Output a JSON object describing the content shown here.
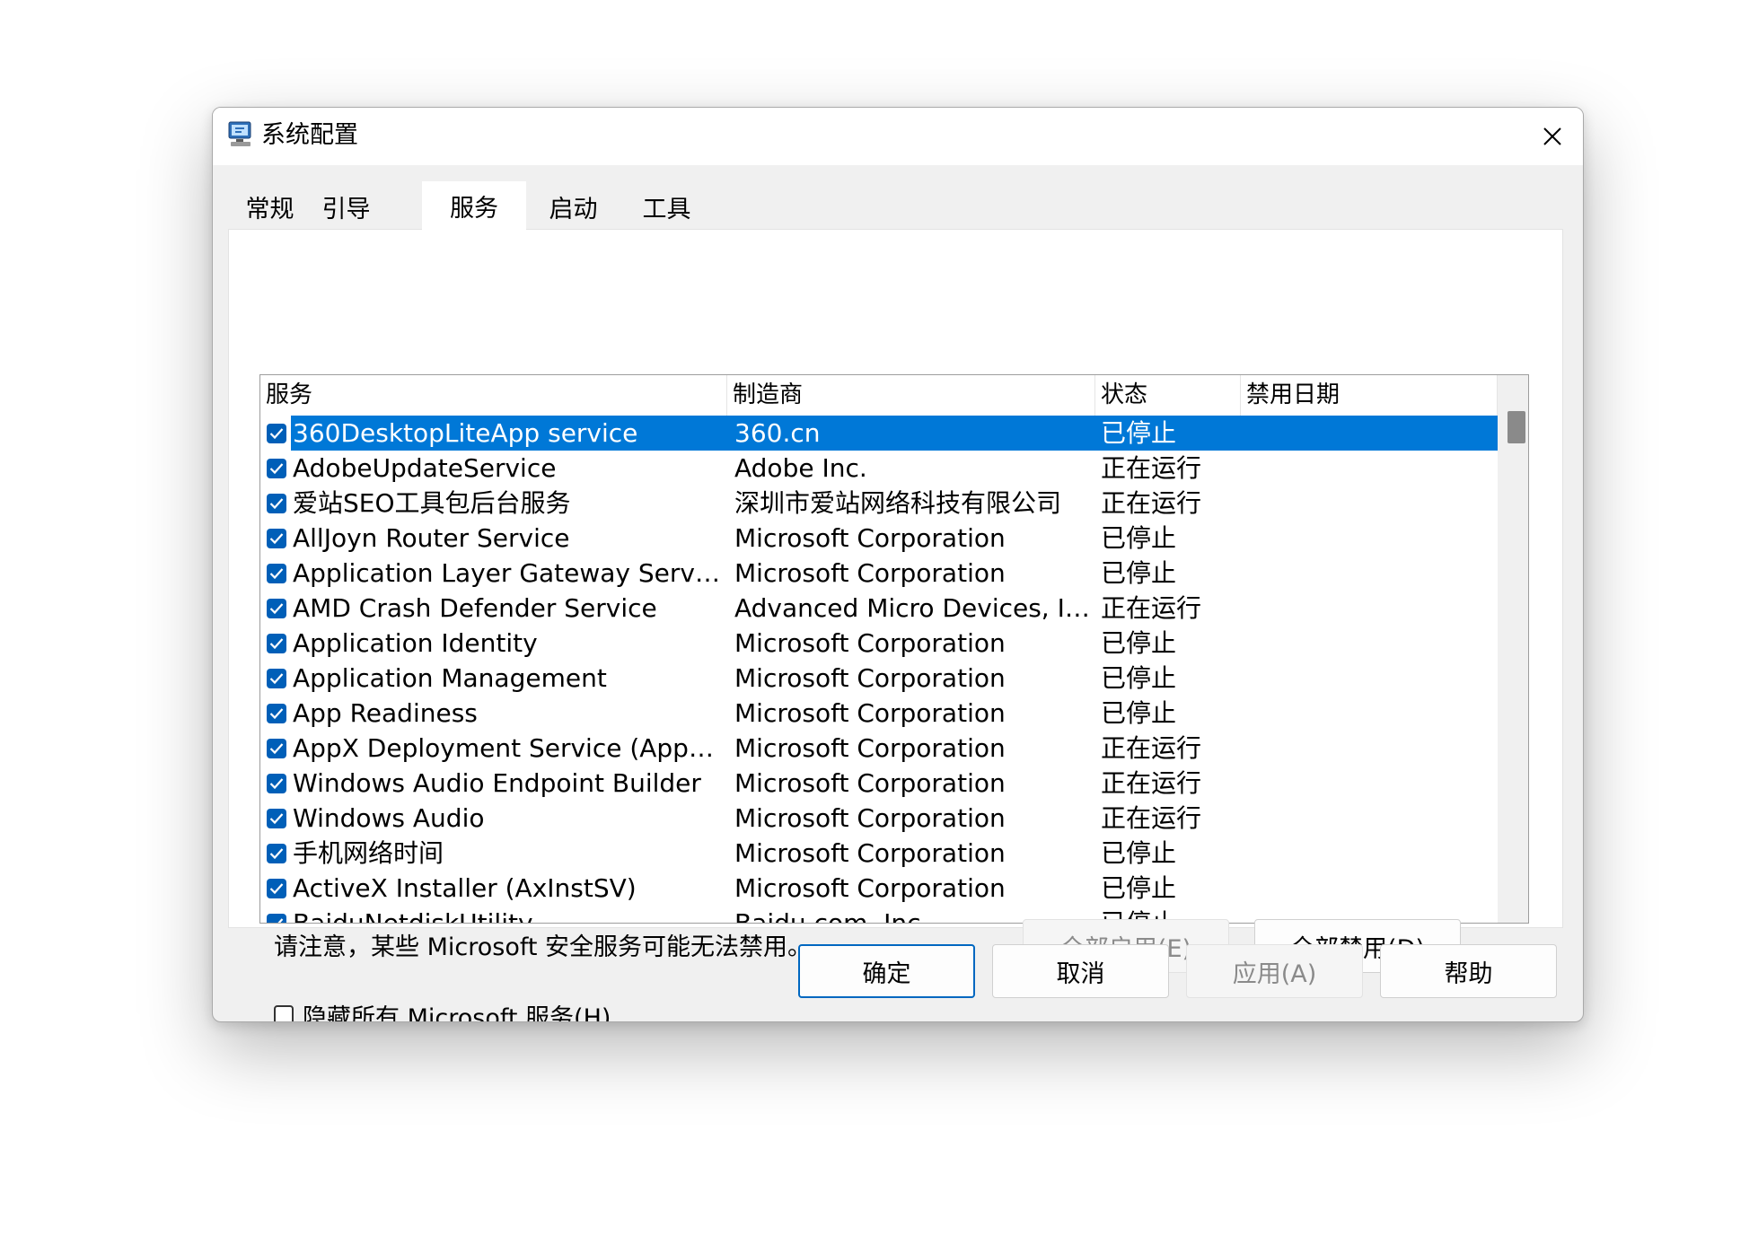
{
  "window": {
    "title": "系统配置",
    "icon": "msconfig-computer-icon"
  },
  "tabs": [
    {
      "label": "常规"
    },
    {
      "label": "引导"
    },
    {
      "label": "服务",
      "active": true
    },
    {
      "label": "启动"
    },
    {
      "label": "工具"
    }
  ],
  "services": {
    "columns": {
      "service": "服务",
      "manufacturer": "制造商",
      "status": "状态",
      "disabled_date": "禁用日期"
    },
    "rows": [
      {
        "name": "360DesktopLiteApp service",
        "manufacturer": "360.cn",
        "status": "已停止",
        "checked": true,
        "selected": true
      },
      {
        "name": "AdobeUpdateService",
        "manufacturer": "Adobe Inc.",
        "status": "正在运行",
        "checked": true
      },
      {
        "name": "爱站SEO工具包后台服务",
        "manufacturer": "深圳市爱站网络科技有限公司",
        "status": "正在运行",
        "checked": true
      },
      {
        "name": "AllJoyn Router Service",
        "manufacturer": "Microsoft Corporation",
        "status": "已停止",
        "checked": true
      },
      {
        "name": "Application Layer Gateway Service",
        "manufacturer": "Microsoft Corporation",
        "status": "已停止",
        "checked": true
      },
      {
        "name": "AMD Crash Defender Service",
        "manufacturer": "Advanced Micro Devices, Inc.",
        "status": "正在运行",
        "checked": true
      },
      {
        "name": "Application Identity",
        "manufacturer": "Microsoft Corporation",
        "status": "已停止",
        "checked": true
      },
      {
        "name": "Application Management",
        "manufacturer": "Microsoft Corporation",
        "status": "已停止",
        "checked": true
      },
      {
        "name": "App Readiness",
        "manufacturer": "Microsoft Corporation",
        "status": "已停止",
        "checked": true
      },
      {
        "name": "AppX Deployment Service (AppXSV...",
        "manufacturer": "Microsoft Corporation",
        "status": "正在运行",
        "checked": true
      },
      {
        "name": "Windows Audio Endpoint Builder",
        "manufacturer": "Microsoft Corporation",
        "status": "正在运行",
        "checked": true
      },
      {
        "name": "Windows Audio",
        "manufacturer": "Microsoft Corporation",
        "status": "正在运行",
        "checked": true
      },
      {
        "name": "手机网络时间",
        "manufacturer": "Microsoft Corporation",
        "status": "已停止",
        "checked": true
      },
      {
        "name": "ActiveX Installer (AxInstSV)",
        "manufacturer": "Microsoft Corporation",
        "status": "已停止",
        "checked": true
      },
      {
        "name": "BaiduNetdiskUtility",
        "manufacturer": "Baidu.com, Inc.",
        "status": "已停止",
        "checked": true
      }
    ]
  },
  "note": "请注意，某些 Microsoft 安全服务可能无法禁用。",
  "buttons": {
    "enable_all": "全部启用(E)",
    "disable_all": "全部禁用(D)",
    "ok": "确定",
    "cancel": "取消",
    "apply": "应用(A)",
    "help": "帮助"
  },
  "hide_ms": {
    "label": "隐藏所有 Microsoft 服务(H)",
    "checked": false
  },
  "colors": {
    "selection": "#0078d7",
    "checkbox": "#005fb8",
    "default_button_border": "#0067c0"
  }
}
